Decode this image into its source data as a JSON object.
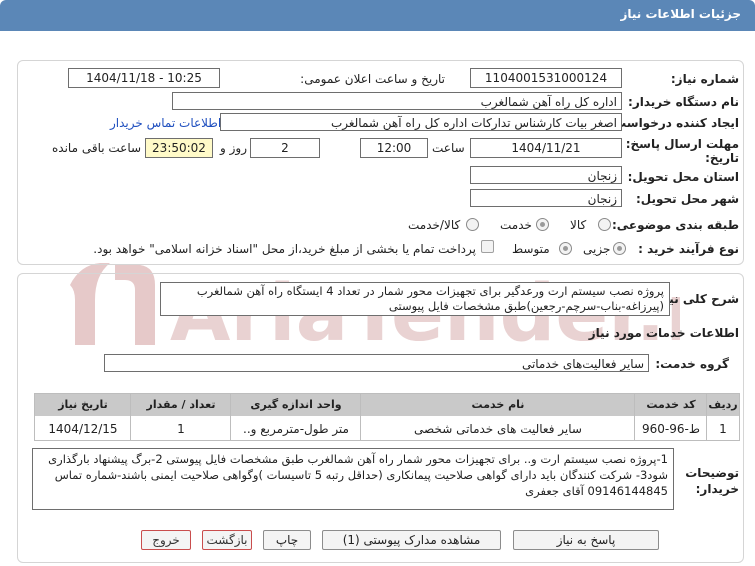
{
  "header": {
    "title": "جزئیات اطلاعات نیاز"
  },
  "form": {
    "need_number_label": "شماره نیاز:",
    "need_number": "1104001531000124",
    "announce_label": "تاریخ و ساعت اعلان عمومی:",
    "announce_value": "1404/11/18 - 10:25",
    "buyer_label": "نام دستگاه خریدار:",
    "buyer_value": "اداره کل راه آهن شمالغرب",
    "requester_label": "ایجاد کننده درخواست:",
    "requester_value": "اصغر بیات کارشناس تدارکات اداره کل راه آهن شمالغرب",
    "contact_link": "اطلاعات تماس خریدار",
    "deadline_label_1": "مهلت ارسال پاسخ: تا",
    "deadline_label_2": "تاریخ:",
    "deadline_date": "1404/11/21",
    "time_label": "ساعت",
    "deadline_time": "12:00",
    "days_value": "2",
    "days_label": "روز و",
    "remaining_time": "23:50:02",
    "remaining_label": "ساعت باقی مانده",
    "province_label": "استان محل تحویل:",
    "province_value": "زنجان",
    "city_label": "شهر محل تحویل:",
    "city_value": "زنجان",
    "category_label": "طبقه بندی موضوعی:",
    "category_options": [
      "کالا",
      "خدمت",
      "کالا/خدمت"
    ],
    "category_selected": "خدمت",
    "process_label": "نوع فرآیند خرید :",
    "process_options": [
      "جزیی",
      "متوسط"
    ],
    "process_selected": "جزیی",
    "payment_note": "پرداخت تمام یا بخشی از مبلغ خرید،از محل \"اسناد خزانه اسلامی\" خواهد بود."
  },
  "summary": {
    "label": "شرح کلی نیاز:",
    "text": "پروژه نصب سیستم ارت ورعدگیر برای تجهیزات محور شمار در تعداد 4 ایستگاه راه آهن شمالغرب (پیرزاغه-بناب-سرچم-رجعین)طبق مشخصات فایل پیوستی"
  },
  "services": {
    "section_title": "اطلاعات خدمات مورد نیاز",
    "group_label": "گروه خدمت:",
    "group_value": "سایر فعالیت‌های خدماتی",
    "columns": [
      "ردیف",
      "کد خدمت",
      "نام خدمت",
      "واحد اندازه گیری",
      "تعداد / مقدار",
      "تاریخ نیاز"
    ],
    "rows": [
      {
        "row": "1",
        "code": "ط-96-960",
        "name": "سایر فعالیت های خدماتی شخصی",
        "unit": "متر طول-مترمربع و..",
        "qty": "1",
        "date": "1404/12/15"
      }
    ]
  },
  "notes": {
    "label_1": "توضیحات",
    "label_2": "خریدار:",
    "text": "1-پروژه نصب سیستم ارت و.. برای تجهیزات محور شمار راه آهن شمالغرب طبق مشخصات فایل پیوستی 2-برگ پیشنهاد بارگذاری شود3- شرکت کنندگان باید دارای گواهی صلاحیت پیمانکاری (حداقل رتبه 5 تاسیسات )وگواهی صلاحیت ایمنی باشند-شماره تماس 09146144845 آقای جعفری"
  },
  "buttons": {
    "respond": "پاسخ به نیاز",
    "attachments": "مشاهده مدارک پیوستی (1)",
    "print": "چاپ",
    "back": "بازگشت",
    "exit": "خروج"
  },
  "watermark": "AriaTender.net",
  "colors": {
    "header_bg": "#5b87b7",
    "table_head_bg": "#c9c9c9",
    "link": "#1f4fbf"
  }
}
